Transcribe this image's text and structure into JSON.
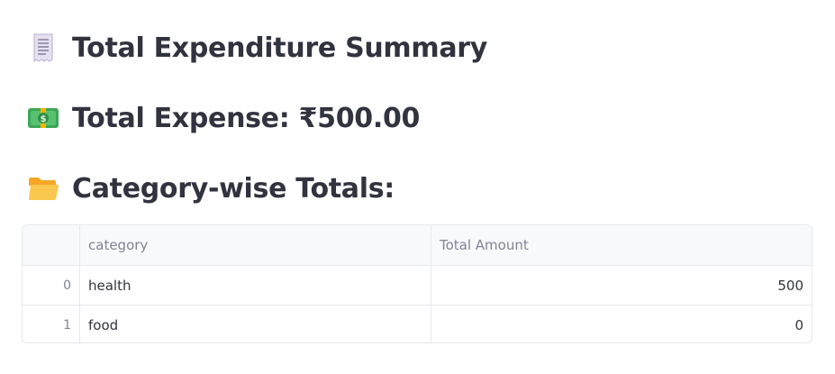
{
  "headings": {
    "summary": "Total Expenditure Summary",
    "total_expense": "Total Expense: ₹500.00",
    "category_totals": "Category-wise Totals:"
  },
  "icons": {
    "summary": "receipt-icon",
    "total_expense": "money-icon",
    "category_totals": "folder-icon"
  },
  "table": {
    "columns": [
      "",
      "category",
      "Total Amount"
    ],
    "rows": [
      {
        "index": "0",
        "category": "health",
        "amount": "500"
      },
      {
        "index": "1",
        "category": "food",
        "amount": "0"
      }
    ]
  }
}
